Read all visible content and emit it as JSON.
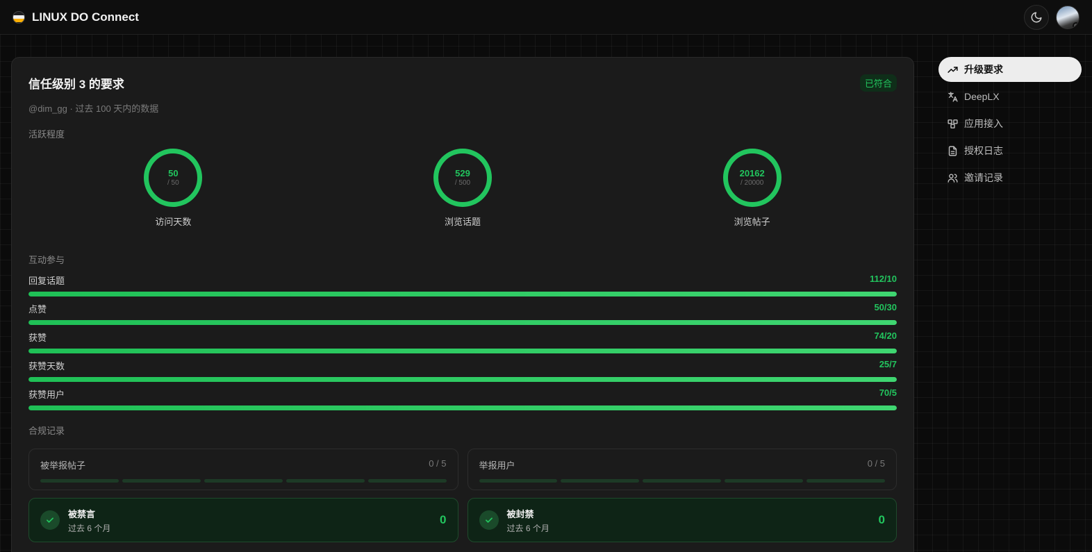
{
  "header": {
    "app_title": "LINUX DO Connect",
    "theme_icon": "moon-icon",
    "avatar_icon": "user-avatar"
  },
  "card": {
    "title": "信任级别 3 的要求",
    "status_badge": "已符合",
    "subtitle": "@dim_gg · 过去 100 天内的数据",
    "activity": {
      "label": "活跃程度",
      "rings": [
        {
          "value": "50",
          "goal": "/ 50",
          "label": "访问天数"
        },
        {
          "value": "529",
          "goal": "/ 500",
          "label": "浏览话题"
        },
        {
          "value": "20162",
          "goal": "/ 20000",
          "label": "浏览帖子"
        }
      ]
    },
    "interaction": {
      "label": "互动参与",
      "bars": [
        {
          "name": "回复话题",
          "value": "112/10",
          "progress": 1.0
        },
        {
          "name": "点赞",
          "value": "50/30",
          "progress": 1.0
        },
        {
          "name": "获赞",
          "value": "74/20",
          "progress": 1.0
        },
        {
          "name": "获赞天数",
          "value": "25/7",
          "progress": 1.0
        },
        {
          "name": "获赞用户",
          "value": "70/5",
          "progress": 1.0
        }
      ]
    },
    "compliance": {
      "label": "合规记录",
      "reports": [
        {
          "name": "被举报帖子",
          "count": "0 / 5"
        },
        {
          "name": "举报用户",
          "count": "0 / 5"
        }
      ],
      "bans": [
        {
          "title": "被禁言",
          "sub": "过去 6 个月",
          "count": "0"
        },
        {
          "title": "被封禁",
          "sub": "过去 6 个月",
          "count": "0"
        }
      ]
    }
  },
  "sidenav": {
    "items": [
      {
        "label": "升级要求",
        "icon": "trending-up-icon",
        "active": true
      },
      {
        "label": "DeepLX",
        "icon": "translate-icon",
        "active": false
      },
      {
        "label": "应用接入",
        "icon": "apps-icon",
        "active": false
      },
      {
        "label": "授权日志",
        "icon": "document-icon",
        "active": false
      },
      {
        "label": "邀请记录",
        "icon": "users-icon",
        "active": false
      }
    ]
  },
  "colors": {
    "accent": "#22c55e",
    "background": "#0b0b0b",
    "card": "#1b1b1b"
  }
}
